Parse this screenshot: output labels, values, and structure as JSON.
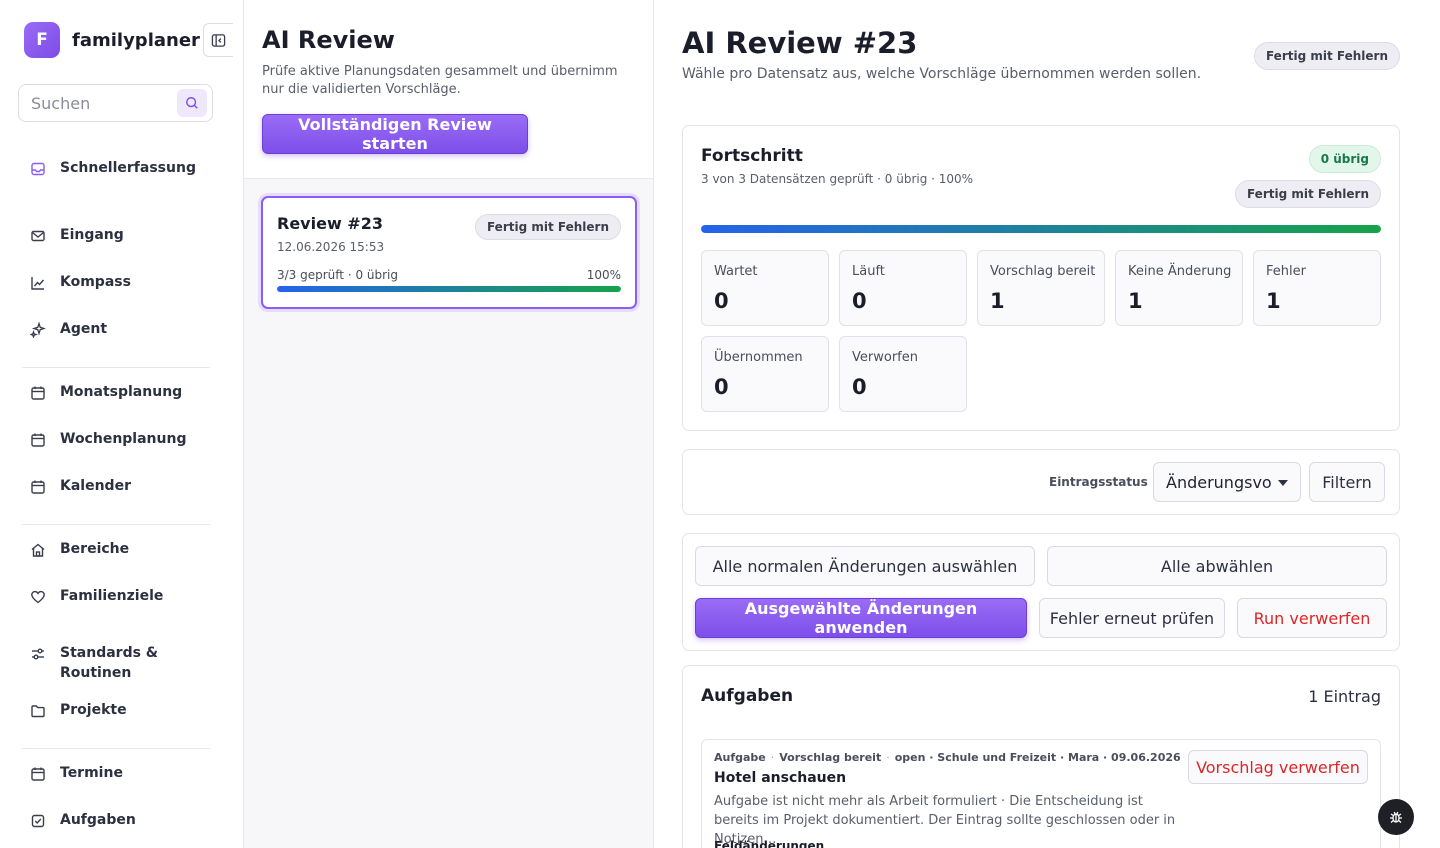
{
  "app": {
    "logo_letter": "F",
    "name": "familyplaner"
  },
  "search": {
    "placeholder": "Suchen"
  },
  "nav": {
    "quick": "Schnellerfassung",
    "inbox": "Eingang",
    "compass": "Kompass",
    "agent": "Agent",
    "monthly": "Monatsplanung",
    "weekly": "Wochenplanung",
    "calendar": "Kalender",
    "areas": "Bereiche",
    "goals": "Familienziele",
    "standards": "Standards & Routinen",
    "projects": "Projekte",
    "appointments": "Termine",
    "tasks": "Aufgaben"
  },
  "review_list": {
    "title": "AI Review",
    "subtitle": "Prüfe aktive Planungsdaten gesammelt und übernimm nur die validierten Vorschläge.",
    "start_button": "Vollständigen Review starten",
    "items": [
      {
        "title": "Review #23",
        "date": "12.06.2026 15:53",
        "status": "Fertig mit Fehlern",
        "progress_text": "3/3 geprüft · 0 übrig",
        "percent_label": "100%",
        "progress": 1.0
      }
    ]
  },
  "detail": {
    "title": "AI Review #23",
    "subtitle": "Wähle pro Datensatz aus, welche Vorschläge übernommen werden sollen.",
    "status": "Fertig mit Fehlern",
    "progress": {
      "title": "Fortschritt",
      "subtitle": "3 von 3 Datensätzen geprüft · 0 übrig · 100%",
      "remaining_badge": "0 übrig",
      "status_badge": "Fertig mit Fehlern",
      "fraction": 1.0,
      "stats": [
        {
          "label": "Wartet",
          "value": "0"
        },
        {
          "label": "Läuft",
          "value": "0"
        },
        {
          "label": "Vorschlag bereit",
          "value": "1"
        },
        {
          "label": "Keine Änderung",
          "value": "1"
        },
        {
          "label": "Fehler",
          "value": "1"
        },
        {
          "label": "Übernommen",
          "value": "0"
        },
        {
          "label": "Verworfen",
          "value": "0"
        }
      ]
    },
    "filter": {
      "label": "Eintragsstatus",
      "selected": "Änderungsvo",
      "button": "Filtern"
    },
    "actions": {
      "select_all": "Alle normalen Änderungen auswählen",
      "deselect_all": "Alle abwählen",
      "apply": "Ausgewählte Änderungen anwenden",
      "recheck": "Fehler erneut prüfen",
      "discard_run": "Run verwerfen"
    },
    "tasks": {
      "title": "Aufgaben",
      "count": "1 Eintrag",
      "entries": [
        {
          "type": "Aufgabe",
          "status": "Vorschlag bereit",
          "meta": "open · Schule und Freizeit · Mara · 09.06.2026",
          "title": "Hotel anschauen",
          "description": "Aufgabe ist nicht mehr als Arbeit formuliert · Die Entscheidung ist bereits im Projekt dokumentiert. Der Eintrag sollte geschlossen oder in Notizen…",
          "reject": "Vorschlag verwerfen",
          "section": "Feldänderungen"
        }
      ]
    }
  },
  "colors": {
    "accent": "#8b5cf6",
    "success": "#16a34a",
    "danger": "#dc2626",
    "progress_start": "#2563eb"
  }
}
